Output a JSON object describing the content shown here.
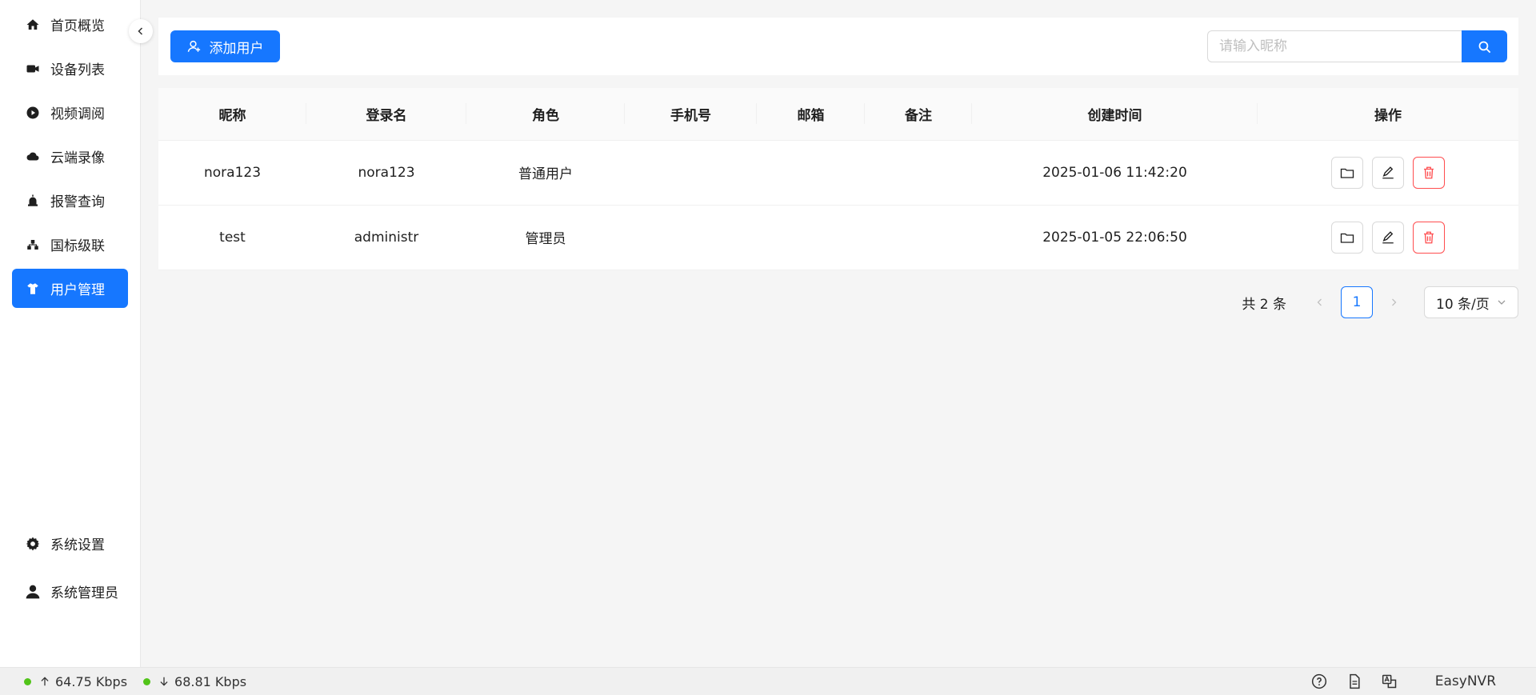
{
  "sidebar": {
    "items": [
      {
        "label": "首页概览",
        "icon": "home-icon"
      },
      {
        "label": "设备列表",
        "icon": "camera-icon"
      },
      {
        "label": "视频调阅",
        "icon": "play-circle-icon"
      },
      {
        "label": "云端录像",
        "icon": "cloud-icon"
      },
      {
        "label": "报警查询",
        "icon": "alarm-icon"
      },
      {
        "label": "国标级联",
        "icon": "cascade-icon"
      },
      {
        "label": "用户管理",
        "icon": "user-manage-icon",
        "active": true
      },
      {
        "label": "系统设置",
        "icon": "gear-icon"
      },
      {
        "label": "系统管理员",
        "icon": "user-icon"
      }
    ]
  },
  "toolbar": {
    "add_user_label": "添加用户",
    "search_placeholder": "请输入昵称"
  },
  "table": {
    "columns": [
      "昵称",
      "登录名",
      "角色",
      "手机号",
      "邮箱",
      "备注",
      "创建时间",
      "操作"
    ],
    "rows": [
      {
        "nickname": "nora123",
        "login": "nora123",
        "role": "普通用户",
        "phone": "",
        "email": "",
        "remark": "",
        "created": "2025-01-06 11:42:20"
      },
      {
        "nickname": "test",
        "login": "administr",
        "role": "管理员",
        "phone": "",
        "email": "",
        "remark": "",
        "created": "2025-01-05 22:06:50"
      }
    ]
  },
  "pagination": {
    "total": "共 2 条",
    "current_page": "1",
    "page_size": "10 条/页"
  },
  "status": {
    "upload": "64.75 Kbps",
    "download": "68.81 Kbps",
    "brand": "EasyNVR",
    "indicator_color": "#52c41a"
  },
  "colors": {
    "primary": "#1677ff",
    "danger": "#ff4d4f"
  }
}
